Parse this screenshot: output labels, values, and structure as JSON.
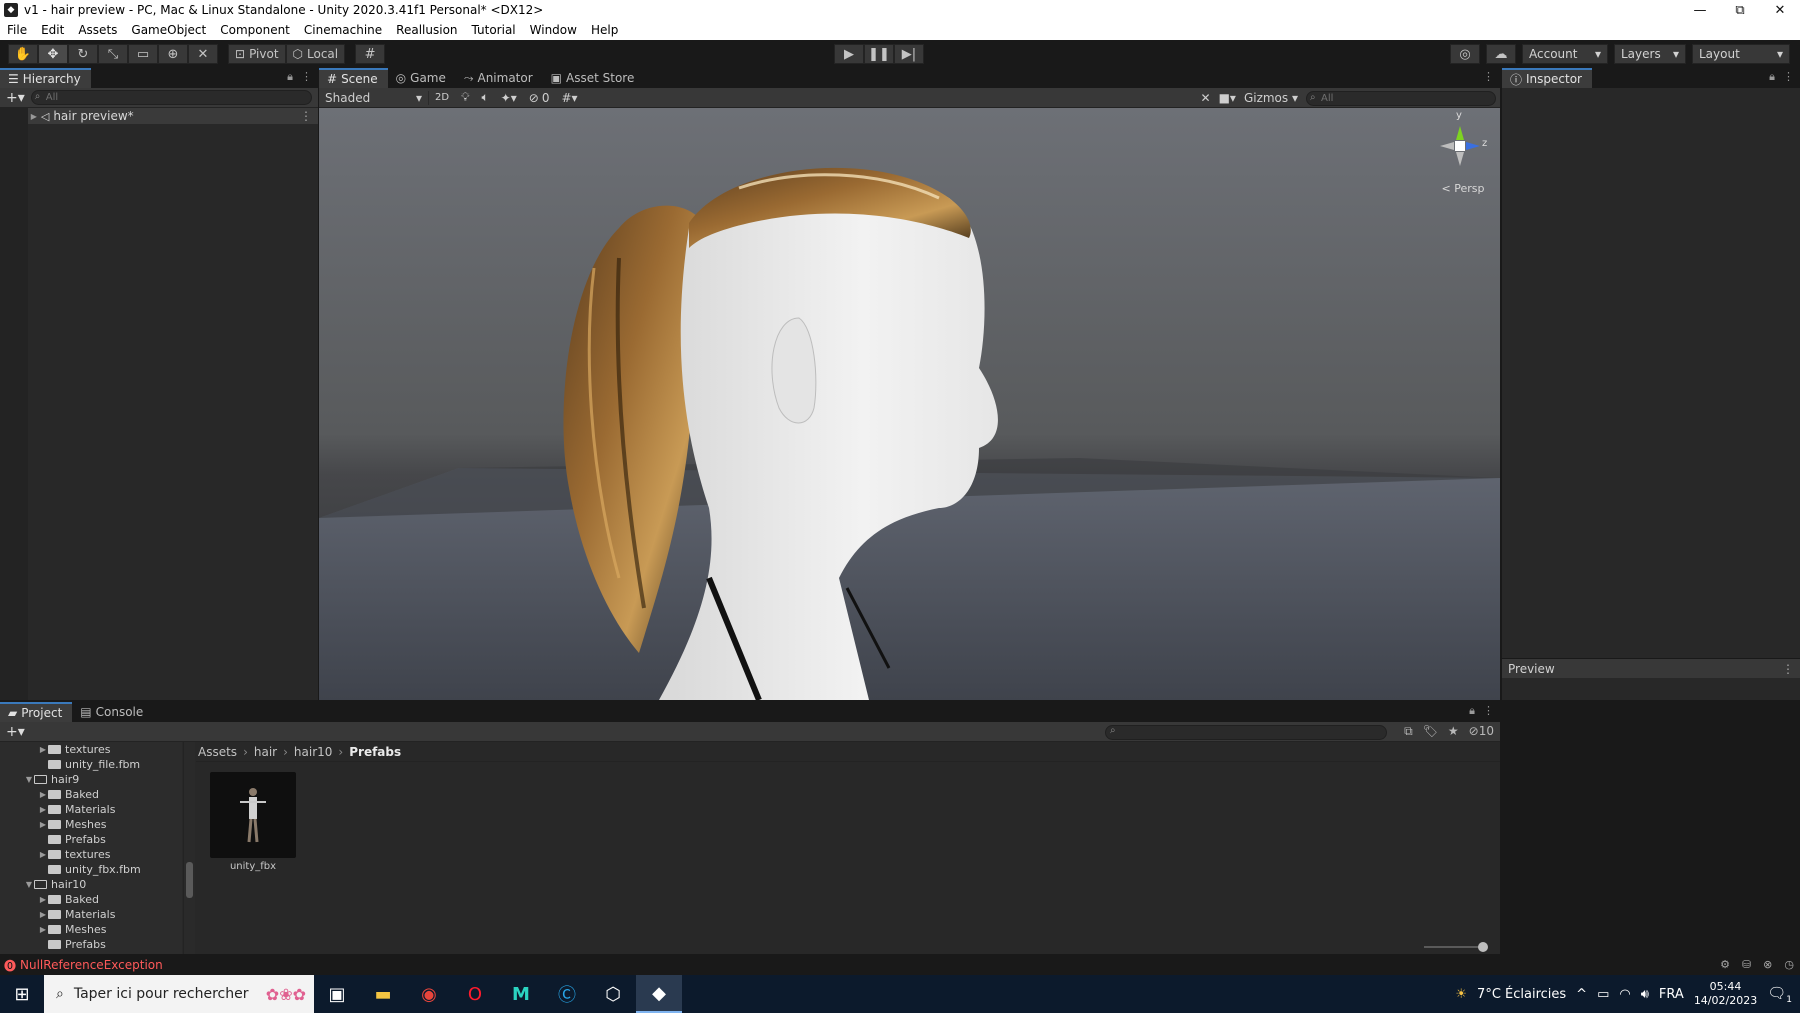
{
  "window": {
    "title": "v1 - hair preview - PC, Mac & Linux Standalone - Unity 2020.3.41f1 Personal* <DX12>",
    "controls": [
      "—",
      "⧉",
      "✕"
    ]
  },
  "menu": [
    "File",
    "Edit",
    "Assets",
    "GameObject",
    "Component",
    "Cinemachine",
    "Reallusion",
    "Tutorial",
    "Window",
    "Help"
  ],
  "toolbar": {
    "pivot_label": "Pivot",
    "local_label": "Local",
    "account_label": "Account",
    "layers_label": "Layers",
    "layout_label": "Layout"
  },
  "hierarchy": {
    "tab_label": "Hierarchy",
    "search_placeholder": "All",
    "scene_item": "hair preview*"
  },
  "scene_view": {
    "tabs": [
      "Scene",
      "Game",
      "Animator",
      "Asset Store"
    ],
    "shading_mode": "Shaded",
    "mode_2d": "2D",
    "hidden_count": "0",
    "gizmos_label": "Gizmos",
    "search_placeholder": "All",
    "persp_label": "< Persp",
    "axis_y": "y",
    "axis_z": "z"
  },
  "inspector": {
    "tab_label": "Inspector",
    "preview_label": "Preview"
  },
  "project": {
    "tabs": [
      "Project",
      "Console"
    ],
    "hidden_count": "10",
    "tree": [
      {
        "label": "textures",
        "indent": 2,
        "arrow": "▶",
        "folder": true
      },
      {
        "label": "unity_file.fbm",
        "indent": 2,
        "arrow": "",
        "folder": true
      },
      {
        "label": "hair9",
        "indent": 1,
        "arrow": "▼",
        "folder": "open"
      },
      {
        "label": "Baked",
        "indent": 2,
        "arrow": "▶",
        "folder": true
      },
      {
        "label": "Materials",
        "indent": 2,
        "arrow": "▶",
        "folder": true
      },
      {
        "label": "Meshes",
        "indent": 2,
        "arrow": "▶",
        "folder": true
      },
      {
        "label": "Prefabs",
        "indent": 2,
        "arrow": "",
        "folder": true
      },
      {
        "label": "textures",
        "indent": 2,
        "arrow": "▶",
        "folder": true
      },
      {
        "label": "unity_fbx.fbm",
        "indent": 2,
        "arrow": "",
        "folder": true
      },
      {
        "label": "hair10",
        "indent": 1,
        "arrow": "▼",
        "folder": "open"
      },
      {
        "label": "Baked",
        "indent": 2,
        "arrow": "▶",
        "folder": true
      },
      {
        "label": "Materials",
        "indent": 2,
        "arrow": "▶",
        "folder": true
      },
      {
        "label": "Meshes",
        "indent": 2,
        "arrow": "▶",
        "folder": true
      },
      {
        "label": "Prefabs",
        "indent": 2,
        "arrow": "",
        "folder": true
      }
    ],
    "breadcrumb": [
      "Assets",
      "hair",
      "hair10",
      "Prefabs"
    ],
    "asset_name": "unity_fbx"
  },
  "status": {
    "error_text": "NullReferenceException"
  },
  "taskbar": {
    "search_placeholder": "Taper ici pour rechercher",
    "weather": "7°C  Éclaircies",
    "language": "FRA",
    "time": "05:44",
    "date": "14/02/2023",
    "notification_count": "1"
  },
  "colors": {
    "accent": "#3a79bb",
    "error": "#ff5a5a",
    "panel": "#282828",
    "toolbar": "#383838"
  }
}
